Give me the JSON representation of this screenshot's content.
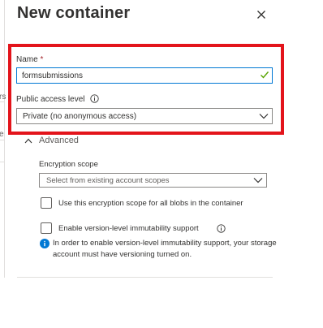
{
  "underlying_page": {
    "fragment_1": "rs",
    "fragment_2": "e"
  },
  "panel": {
    "title": "New container",
    "close_icon": "close-icon"
  },
  "form": {
    "name": {
      "label": "Name",
      "required_marker": "*",
      "value": "formsubmissions",
      "valid_icon": "checkmark-icon"
    },
    "public_access": {
      "label": "Public access level",
      "selected": "Private (no anonymous access)",
      "info_icon": "info-icon"
    },
    "advanced": {
      "label": "Advanced",
      "expanded": true,
      "encryption_scope": {
        "label": "Encryption scope",
        "placeholder": "Select from existing account scopes"
      },
      "use_scope_checkbox": {
        "label": "Use this encryption scope for all blobs in the container",
        "checked": false
      },
      "immutability_checkbox": {
        "label": "Enable version-level immutability support",
        "checked": false
      },
      "info_message": "In order to enable version-level immutability support, your storage account must have versioning turned on."
    }
  },
  "colors": {
    "highlight": "#e3141b",
    "accent": "#0078d4",
    "valid": "#57a300"
  }
}
